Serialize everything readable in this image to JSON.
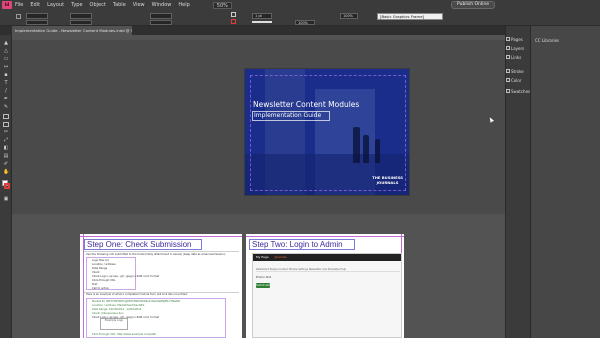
{
  "menubar": {
    "logo": "Id",
    "items": [
      "File",
      "Edit",
      "Layout",
      "Type",
      "Object",
      "Table",
      "View",
      "Window",
      "Help"
    ],
    "zoom": "50%",
    "publish_label": "Publish Online"
  },
  "control": {
    "stroke_weight": "1 pt",
    "percent_a": "100%",
    "percent_b": "100%",
    "frame_style": "[Basic Graphics Frame]"
  },
  "document_tab": "Implementation Guide - Newsletter Content Modules.indd @ 50%",
  "cover": {
    "title": "Newsletter Content Modules",
    "subtitle": "Implementation Guide",
    "brand_line1": "THE BUSINESS",
    "brand_line2": "JOURNALS"
  },
  "left_page": {
    "heading": "Step One: Check Submission",
    "intro": "Use the following info submitted to the ticket (likely attachment in Asana) (keep data as email submission):",
    "fields": [
      "Logo files (2)",
      "Location / address",
      "Date Range",
      "Client",
      "Client Logo (.ai/.eps, .gif, .jpeg) in RGB color format",
      "Click-through URL",
      "Text",
      "Call to action"
    ],
    "note": "Here is an example of what a completed module form will look like once filled:",
    "example": [
      "Market ID: NMT7MKTW0rsgMCP/3N03Sb09a1YKeSHp6NJM1V7NwM6",
      "Location / address: Market/Sent/SantaFe",
      "Date Range: 10/10/2014 - 12/02/2014",
      "Client: Albuquerque Sun",
      "Client Logo (.ai/.eps, .gif, .jpeg) in RGB color format",
      "Click-through URL: http://www.example.com/path"
    ],
    "logo_sample": "Example Logo"
  },
  "right_page": {
    "heading": "Step Two: Login to Admin",
    "site_name": "My Page",
    "site_accent": "Journals",
    "nav_text": "Dashboard  People  Content  Module  Settings  Newsletter  Ads  Templates  Help",
    "label": "Promo Slot",
    "button": "Submit edit"
  },
  "panels": {
    "items": [
      "Pages",
      "Layers",
      "Links",
      "Stroke",
      "Color",
      "Swatches"
    ],
    "cc_libraries": "CC Libraries"
  }
}
